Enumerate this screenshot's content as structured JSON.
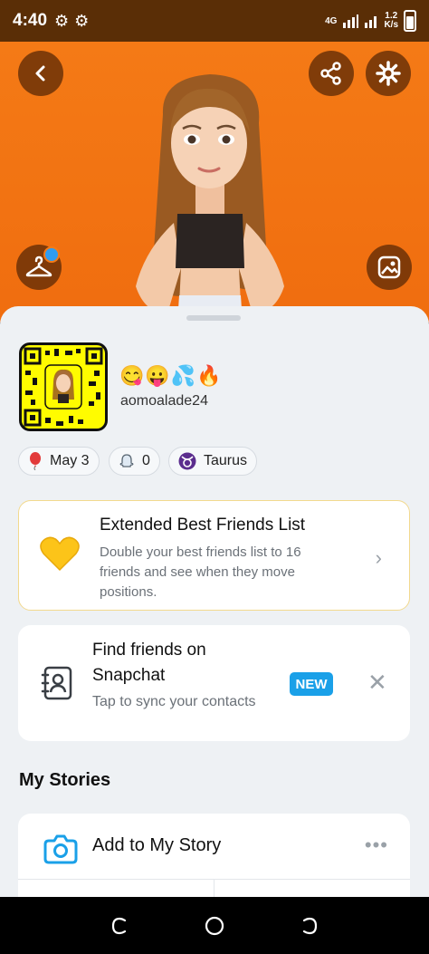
{
  "status_bar": {
    "time": "4:40",
    "network": "4G",
    "speed_value": "1.2",
    "speed_unit": "K/s"
  },
  "hero": {
    "background": "#f47a16"
  },
  "profile": {
    "emojis": "😋😛💦🔥",
    "username": "aomoalade24"
  },
  "chips": {
    "birthday": "May 3",
    "friends": "0",
    "zodiac": "Taurus"
  },
  "extended_bff": {
    "title": "Extended Best Friends List",
    "description": "Double your best friends list to 16 friends and see when they move positions."
  },
  "find_friends": {
    "title": "Find friends on Snapchat",
    "description": "Tap to sync your contacts",
    "badge": "NEW"
  },
  "stories": {
    "section_title": "My Stories",
    "add_label": "Add to My Story"
  },
  "colors": {
    "accent": "#1aa0e8",
    "snap_yellow": "#fffc00",
    "status_bar": "#5a2e06"
  }
}
